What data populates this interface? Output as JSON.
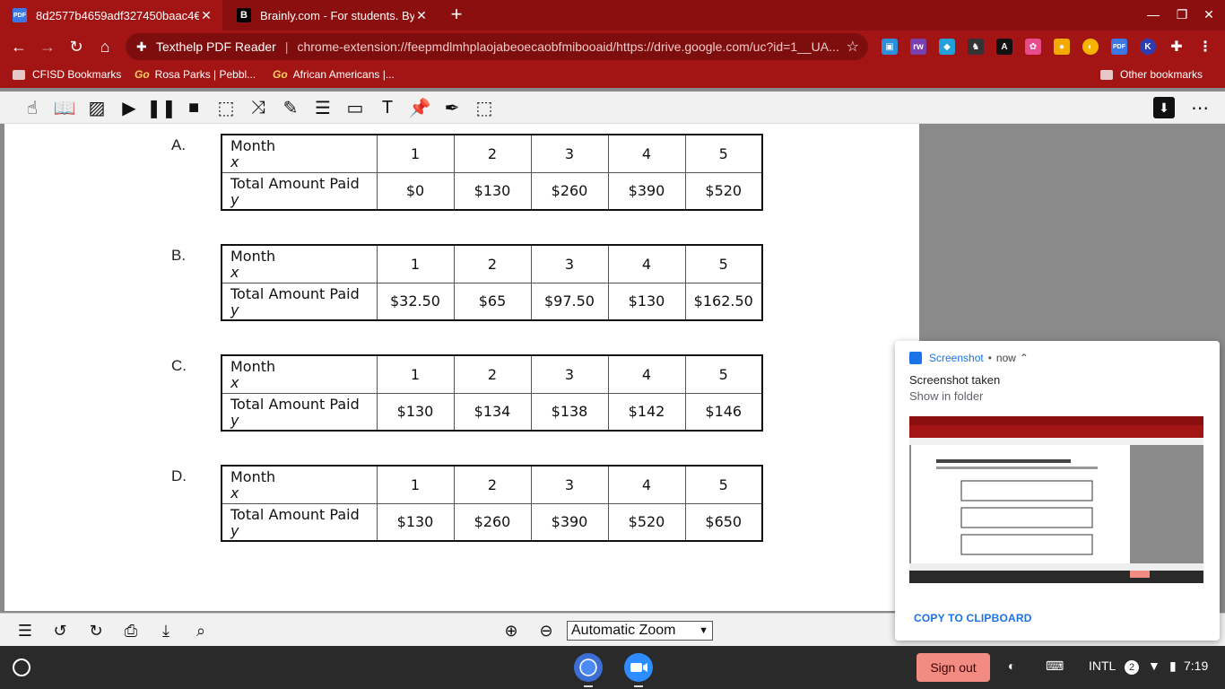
{
  "browser": {
    "tabs": [
      {
        "title": "8d2577b4659adf327450baac4€",
        "favicon": "PDF"
      },
      {
        "title": "Brainly.com - For students. By st",
        "favicon": "B"
      }
    ],
    "address": {
      "site": "Texthelp PDF Reader",
      "url": "chrome-extension://feepmdlmhplaojabeoecaobfmibooaid/https://drive.google.com/uc?id=1__UA..."
    },
    "bookmarks": [
      "CFISD Bookmarks",
      "Rosa Parks | Pebbl...",
      "African Americans |...",
      "Other bookmarks"
    ],
    "bookmark_go": "Go"
  },
  "document": {
    "options": [
      {
        "label": "A.",
        "row1_header": "Month",
        "row1_var": "x",
        "row2_header": "Total Amount Paid",
        "row2_var": "y",
        "x": [
          "1",
          "2",
          "3",
          "4",
          "5"
        ],
        "y": [
          "$0",
          "$130",
          "$260",
          "$390",
          "$520"
        ]
      },
      {
        "label": "B.",
        "row1_header": "Month",
        "row1_var": "x",
        "row2_header": "Total Amount Paid",
        "row2_var": "y",
        "x": [
          "1",
          "2",
          "3",
          "4",
          "5"
        ],
        "y": [
          "$32.50",
          "$65",
          "$97.50",
          "$130",
          "$162.50"
        ]
      },
      {
        "label": "C.",
        "row1_header": "Month",
        "row1_var": "x",
        "row2_header": "Total Amount Paid",
        "row2_var": "y",
        "x": [
          "1",
          "2",
          "3",
          "4",
          "5"
        ],
        "y": [
          "$130",
          "$134",
          "$138",
          "$142",
          "$146"
        ]
      },
      {
        "label": "D.",
        "row1_header": "Month",
        "row1_var": "x",
        "row2_header": "Total Amount Paid",
        "row2_var": "y",
        "x": [
          "1",
          "2",
          "3",
          "4",
          "5"
        ],
        "y": [
          "$130",
          "$260",
          "$390",
          "$520",
          "$650"
        ]
      }
    ]
  },
  "pdf_bottom": {
    "zoom": "Automatic Zoom"
  },
  "notification": {
    "app": "Screenshot",
    "time": "now",
    "title": "Screenshot taken",
    "subtitle": "Show in folder",
    "action": "COPY TO CLIPBOARD"
  },
  "shelf": {
    "signout": "Sign out",
    "ime": "INTL",
    "badge": "2",
    "time": "7:19"
  }
}
